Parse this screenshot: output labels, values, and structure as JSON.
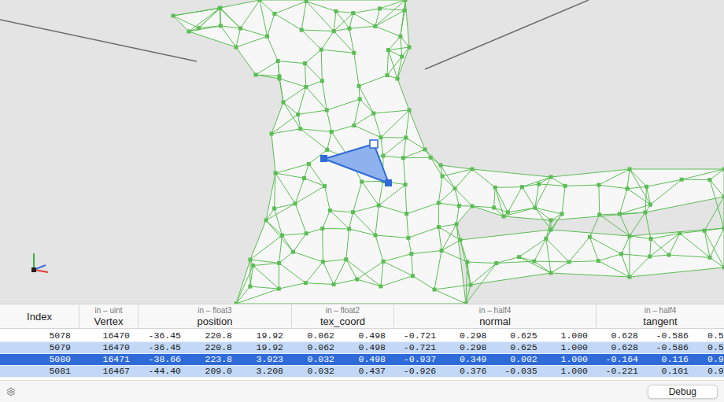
{
  "table": {
    "columns": [
      {
        "qualifier": "",
        "name": "Index"
      },
      {
        "qualifier": "in – uint",
        "name": "Vertex"
      },
      {
        "qualifier": "in – float3",
        "name": "position"
      },
      {
        "qualifier": "in – float2",
        "name": "tex_coord"
      },
      {
        "qualifier": "in – half4",
        "name": "normal"
      },
      {
        "qualifier": "in – half4",
        "name": "tangent"
      }
    ],
    "rows": [
      {
        "cells": [
          [
            "5078"
          ],
          [
            "16470"
          ],
          [
            "-36.45",
            "220.8",
            "19.92"
          ],
          [
            "0.062",
            "0.498"
          ],
          [
            "-0.721",
            "0.298",
            "0.625",
            "1.000"
          ],
          [
            "0.628",
            "-0.586",
            "0.5"
          ]
        ],
        "selected": false,
        "in_primitive": false
      },
      {
        "cells": [
          [
            "5079"
          ],
          [
            "16470"
          ],
          [
            "-36.45",
            "220.8",
            "19.92"
          ],
          [
            "0.062",
            "0.498"
          ],
          [
            "-0.721",
            "0.298",
            "0.625",
            "1.000"
          ],
          [
            "0.628",
            "-0.586",
            "0.5"
          ]
        ],
        "selected": false,
        "in_primitive": true
      },
      {
        "cells": [
          [
            "5080"
          ],
          [
            "16471"
          ],
          [
            "-38.66",
            "223.8",
            "3.923"
          ],
          [
            "0.032",
            "0.498"
          ],
          [
            "-0.937",
            "0.349",
            "0.002",
            "1.000"
          ],
          [
            "-0.164",
            "0.116",
            "0.9"
          ]
        ],
        "selected": true,
        "in_primitive": true
      },
      {
        "cells": [
          [
            "5081"
          ],
          [
            "16467"
          ],
          [
            "-44.40",
            "209.0",
            "3.208"
          ],
          [
            "0.032",
            "0.437"
          ],
          [
            "-0.926",
            "0.376",
            "-0.035",
            "1.000"
          ],
          [
            "-0.221",
            "0.101",
            "0.9"
          ]
        ],
        "selected": false,
        "in_primitive": true
      }
    ]
  },
  "bottom_bar": {
    "buttons": [
      "Debug"
    ]
  }
}
